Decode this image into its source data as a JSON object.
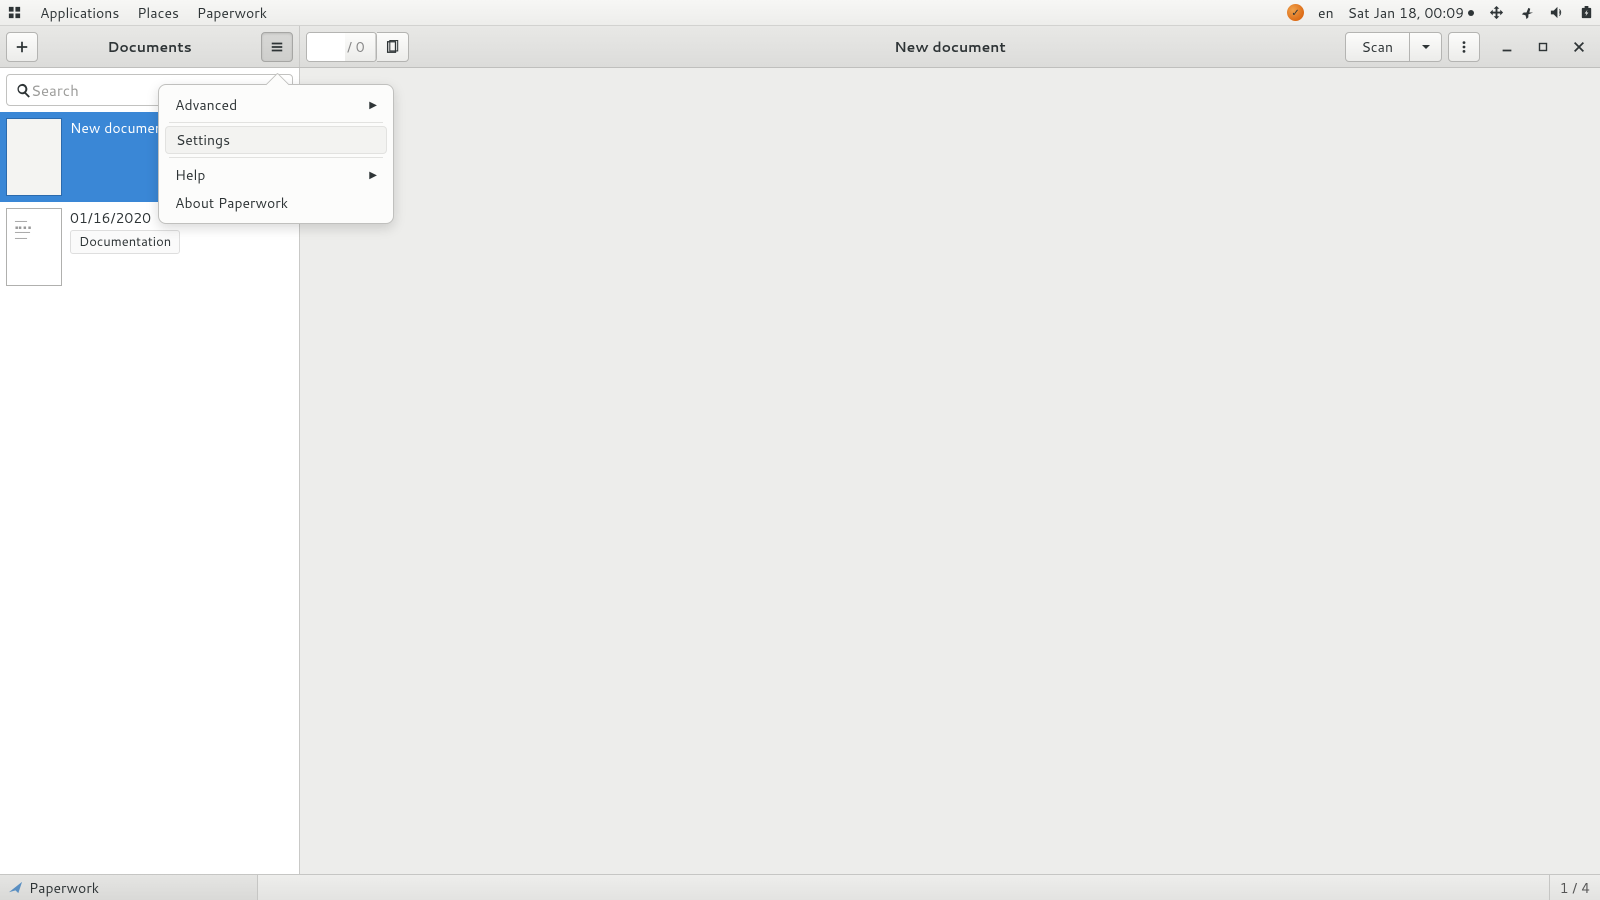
{
  "topbar": {
    "menus": [
      "Applications",
      "Places",
      "Paperwork"
    ],
    "lang": "en",
    "clock": "Sat Jan 18, 00:09"
  },
  "header": {
    "left_title": "Documents",
    "page_value": "",
    "page_total": "/ 0",
    "doc_title": "New document",
    "scan_label": "Scan"
  },
  "search": {
    "placeholder": "Search"
  },
  "docs": [
    {
      "title": "New document",
      "selected": true
    },
    {
      "title": "01/16/2020",
      "tag": "Documentation",
      "selected": false
    }
  ],
  "menu": {
    "advanced": "Advanced",
    "settings": "Settings",
    "help": "Help",
    "about": "About Paperwork"
  },
  "taskbar": {
    "app": "Paperwork",
    "workspace": "1 / 4"
  }
}
